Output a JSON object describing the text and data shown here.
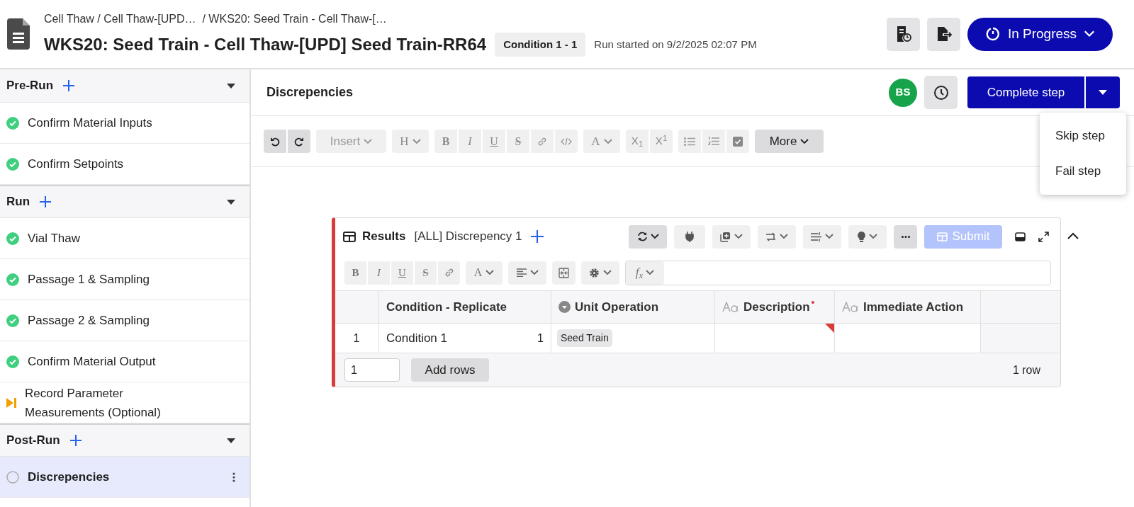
{
  "header": {
    "breadcrumb": "Cell Thaw / Cell Thaw-[UPD…  / WKS20: Seed Train - Cell Thaw-[…",
    "title": "WKS20: Seed Train - Cell Thaw-[UPD] Seed Train-RR64",
    "condition_badge": "Condition 1 - 1",
    "run_started": "Run started on 9/2/2025 02:07 PM",
    "status_button": "In Progress"
  },
  "sidebar": {
    "sections": [
      {
        "title": "Pre-Run",
        "steps": [
          {
            "label": "Confirm Material Inputs",
            "kind": "done",
            "selected": false
          },
          {
            "label": "Confirm Setpoints",
            "kind": "done",
            "selected": false
          }
        ]
      },
      {
        "title": "Run",
        "steps": [
          {
            "label": "Vial Thaw",
            "kind": "done",
            "selected": false
          },
          {
            "label": "Passage 1 & Sampling",
            "kind": "done",
            "selected": false
          },
          {
            "label": "Passage 2 & Sampling",
            "kind": "done",
            "selected": false
          },
          {
            "label": "Confirm Material Output",
            "kind": "done",
            "selected": false
          },
          {
            "label": "Record Parameter Measurements (Optional)",
            "kind": "skipped",
            "selected": false
          }
        ]
      },
      {
        "title": "Post-Run",
        "steps": [
          {
            "label": "Discrepencies",
            "kind": "pending",
            "selected": true
          }
        ]
      }
    ]
  },
  "step": {
    "title": "Discrepencies",
    "avatar": "BS",
    "complete_button": "Complete step",
    "menu": [
      "Skip step",
      "Fail step"
    ]
  },
  "editor_toolbar": {
    "insert": "Insert",
    "heading": "H",
    "bold": "B",
    "italic": "I",
    "underline": "U",
    "strike": "S",
    "font_color": "A",
    "subscript": "X$_{1}$",
    "superscript": "X$^{1}$",
    "more": "More"
  },
  "table_widget": {
    "type_label": "Results",
    "name": "[ALL] Discrepency 1",
    "submit": "Submit",
    "submit_disabled": true,
    "format_toolbar": {
      "bold": "B",
      "italic": "I",
      "underline": "U",
      "strike": "S",
      "font_color": "A",
      "formula": "f$_{x}$"
    },
    "columns": [
      {
        "label": "Condition - Replicate",
        "kind": "plain",
        "required": false
      },
      {
        "label": "Unit Operation",
        "kind": "select",
        "required": false
      },
      {
        "label": "Description",
        "kind": "text",
        "required": true
      },
      {
        "label": "Immediate Action",
        "kind": "text",
        "required": false
      }
    ],
    "rows": [
      {
        "number": "1",
        "cells": [
          {
            "text": "Condition 1",
            "replicate": "1"
          },
          {
            "tag": "Seed Train"
          },
          {
            "missing": true
          },
          {
            "missing": false
          }
        ]
      }
    ],
    "rows_input": "1",
    "add_rows": "Add rows",
    "row_count": "1 row"
  }
}
